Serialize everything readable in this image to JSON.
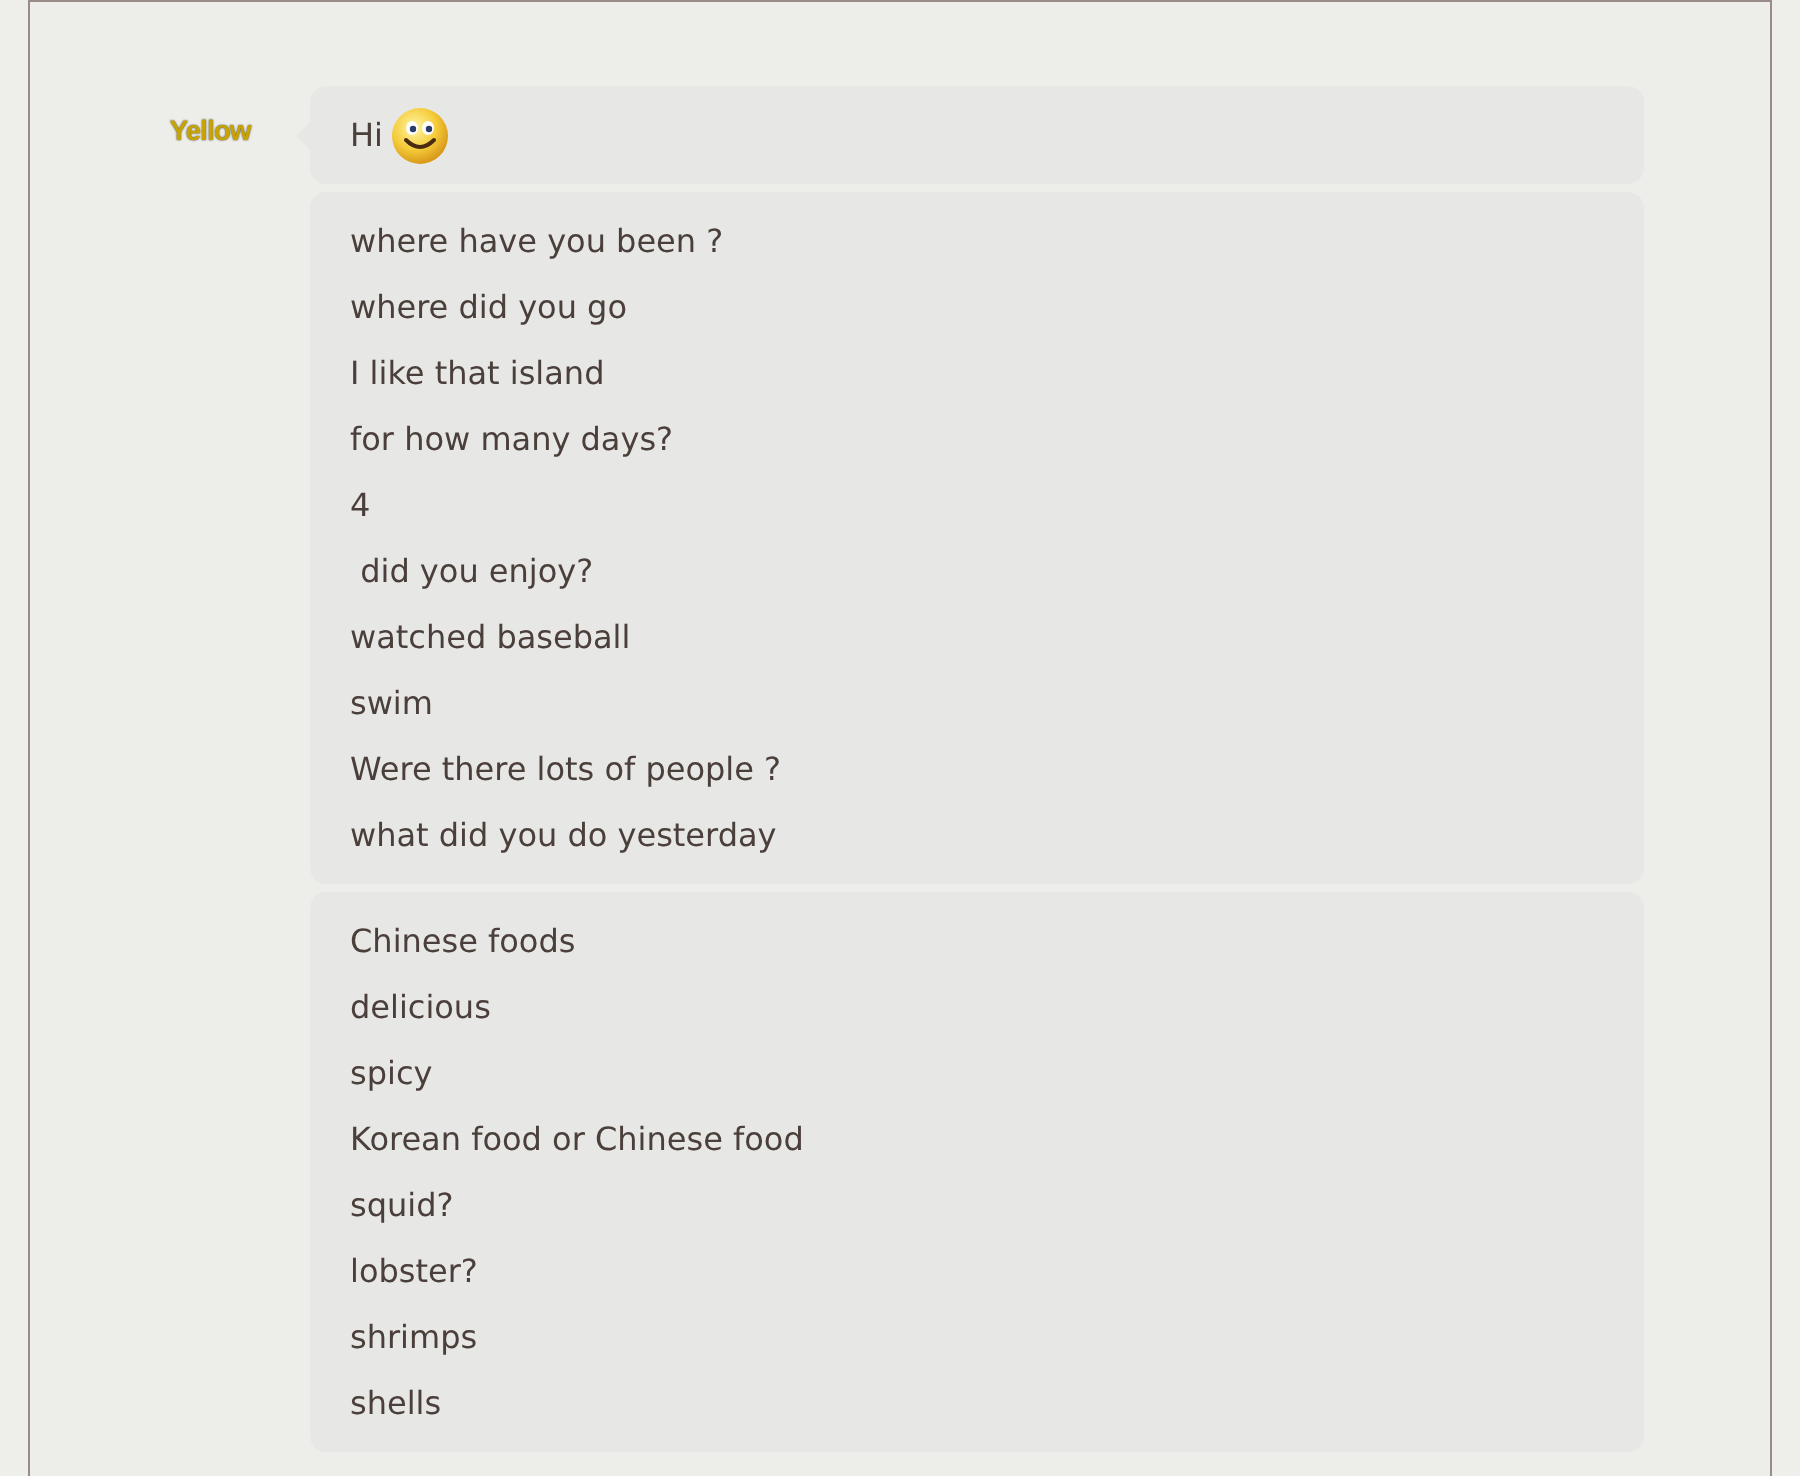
{
  "sender": {
    "logo": "Yellow"
  },
  "messages": [
    {
      "lines": [
        "Hi"
      ],
      "emoji": true
    },
    {
      "lines": [
        "where have you been ?",
        "where did you go",
        "I like that island",
        "for how many days?",
        "4",
        " did you enjoy?",
        "watched baseball",
        "swim",
        "Were there lots of people ?",
        "what did you do yesterday"
      ],
      "emoji": false
    },
    {
      "lines": [
        "Chinese foods",
        "delicious",
        "spicy",
        "Korean food or Chinese food",
        "squid?",
        "lobster?",
        "shrimps",
        "shells"
      ],
      "emoji": false
    }
  ]
}
